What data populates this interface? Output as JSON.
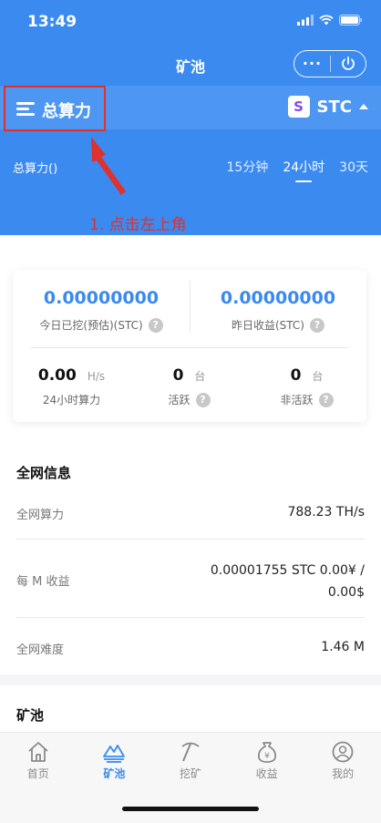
{
  "status": {
    "time": "13:49"
  },
  "nav": {
    "title": "矿池",
    "more_label": "···"
  },
  "subbar": {
    "menu_label": "总算力",
    "coin_logo": "S",
    "coin_name": "STC"
  },
  "hashrate": {
    "label": "总算力()",
    "ranges": [
      "15分钟",
      "24小时",
      "30天"
    ],
    "active_range": "24小时"
  },
  "annotation": {
    "text": "1. 点击左上角",
    "color": "#e0312c"
  },
  "summary": {
    "mined_today_value": "0.00000000",
    "mined_today_label": "今日已挖(预估)(STC)",
    "yesterday_value": "0.00000000",
    "yesterday_label": "昨日收益(STC)",
    "hashrate_24h_value": "0.00",
    "hashrate_24h_unit": "H/s",
    "hashrate_24h_label": "24小时算力",
    "active_value": "0",
    "active_unit": "台",
    "active_label": "活跃",
    "inactive_value": "0",
    "inactive_unit": "台",
    "inactive_label": "非活跃",
    "help_glyph": "?"
  },
  "network": {
    "title": "全网信息",
    "rows": [
      {
        "key": "全网算力",
        "value": "788.23 TH/s"
      },
      {
        "key": "每 M 收益",
        "value_line1": "0.00001755 STC 0.00¥ /",
        "value_line2": "0.00$"
      },
      {
        "key": "全网难度",
        "value": "1.46 M"
      }
    ]
  },
  "pool": {
    "title": "矿池"
  },
  "tabs": [
    {
      "label": "首页",
      "icon": "home-icon"
    },
    {
      "label": "矿池",
      "icon": "pool-icon"
    },
    {
      "label": "挖矿",
      "icon": "pickaxe-icon"
    },
    {
      "label": "收益",
      "icon": "moneybag-icon"
    },
    {
      "label": "我的",
      "icon": "user-icon"
    }
  ],
  "colors": {
    "primary": "#3a8af0",
    "subbar": "#4d97f3",
    "annotation": "#e0312c"
  }
}
